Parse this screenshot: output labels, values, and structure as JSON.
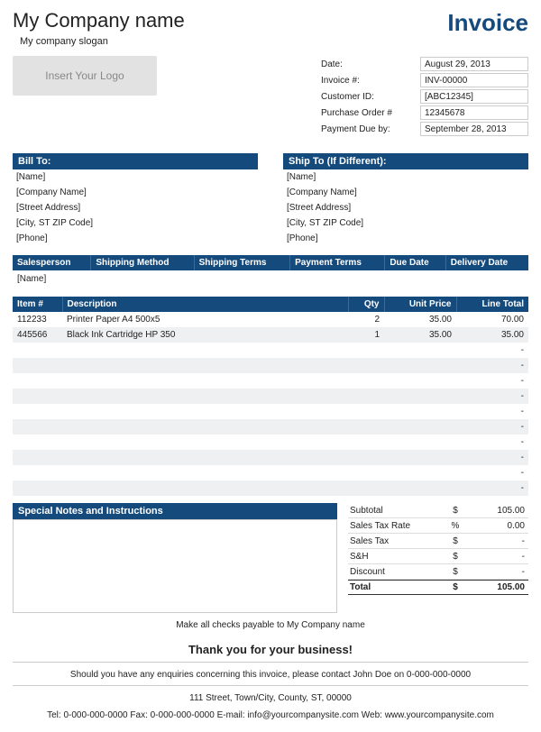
{
  "company": {
    "name": "My Company name",
    "slogan": "My company slogan",
    "logo_placeholder": "Insert Your Logo"
  },
  "doc_title": "Invoice",
  "meta": {
    "date_label": "Date:",
    "date": "August 29, 2013",
    "invoice_no_label": "Invoice #:",
    "invoice_no": "INV-00000",
    "customer_id_label": "Customer ID:",
    "customer_id": "[ABC12345]",
    "po_label": "Purchase Order #",
    "po": "12345678",
    "due_label": "Payment Due by:",
    "due": "September 28, 2013"
  },
  "billto_header": "Bill To:",
  "shipto_header": "Ship To (If Different):",
  "billto": [
    "[Name]",
    "[Company Name]",
    "[Street Address]",
    "[City, ST  ZIP Code]",
    "[Phone]"
  ],
  "shipto": [
    "[Name]",
    "[Company Name]",
    "[Street Address]",
    "[City, ST  ZIP Code]",
    "[Phone]"
  ],
  "sales_headers": [
    "Salesperson",
    "Shipping Method",
    "Shipping Terms",
    "Payment Terms",
    "Due Date",
    "Delivery Date"
  ],
  "sales_row": [
    "[Name]",
    "",
    "",
    "",
    "",
    ""
  ],
  "item_headers": {
    "item": "Item #",
    "desc": "Description",
    "qty": "Qty",
    "price": "Unit Price",
    "total": "Line Total"
  },
  "items": [
    {
      "item": "112233",
      "desc": "Printer Paper A4 500x5",
      "qty": "2",
      "price": "35.00",
      "total": "70.00"
    },
    {
      "item": "445566",
      "desc": "Black Ink Cartridge HP 350",
      "qty": "1",
      "price": "35.00",
      "total": "35.00"
    },
    {
      "item": "",
      "desc": "",
      "qty": "",
      "price": "",
      "total": "-"
    },
    {
      "item": "",
      "desc": "",
      "qty": "",
      "price": "",
      "total": "-"
    },
    {
      "item": "",
      "desc": "",
      "qty": "",
      "price": "",
      "total": "-"
    },
    {
      "item": "",
      "desc": "",
      "qty": "",
      "price": "",
      "total": "-"
    },
    {
      "item": "",
      "desc": "",
      "qty": "",
      "price": "",
      "total": "-"
    },
    {
      "item": "",
      "desc": "",
      "qty": "",
      "price": "",
      "total": "-"
    },
    {
      "item": "",
      "desc": "",
      "qty": "",
      "price": "",
      "total": "-"
    },
    {
      "item": "",
      "desc": "",
      "qty": "",
      "price": "",
      "total": "-"
    },
    {
      "item": "",
      "desc": "",
      "qty": "",
      "price": "",
      "total": "-"
    },
    {
      "item": "",
      "desc": "",
      "qty": "",
      "price": "",
      "total": "-"
    }
  ],
  "notes_header": "Special Notes and Instructions",
  "totals": {
    "subtotal": {
      "label": "Subtotal",
      "sym": "$",
      "val": "105.00"
    },
    "taxrate": {
      "label": "Sales Tax Rate",
      "sym": "%",
      "val": "0.00"
    },
    "tax": {
      "label": "Sales Tax",
      "sym": "$",
      "val": "-"
    },
    "sh": {
      "label": "S&H",
      "sym": "$",
      "val": "-"
    },
    "discount": {
      "label": "Discount",
      "sym": "$",
      "val": "-"
    },
    "total": {
      "label": "Total",
      "sym": "$",
      "val": "105.00"
    }
  },
  "footer": {
    "payable": "Make all checks payable to My Company name",
    "thanks": "Thank you for your business!",
    "enquiries": "Should you have any enquiries concerning this invoice, please contact John Doe on 0-000-000-0000",
    "address": "111 Street, Town/City, County, ST, 00000",
    "contact": "Tel: 0-000-000-0000 Fax: 0-000-000-0000 E-mail: info@yourcompanysite.com Web: www.yourcompanysite.com"
  }
}
